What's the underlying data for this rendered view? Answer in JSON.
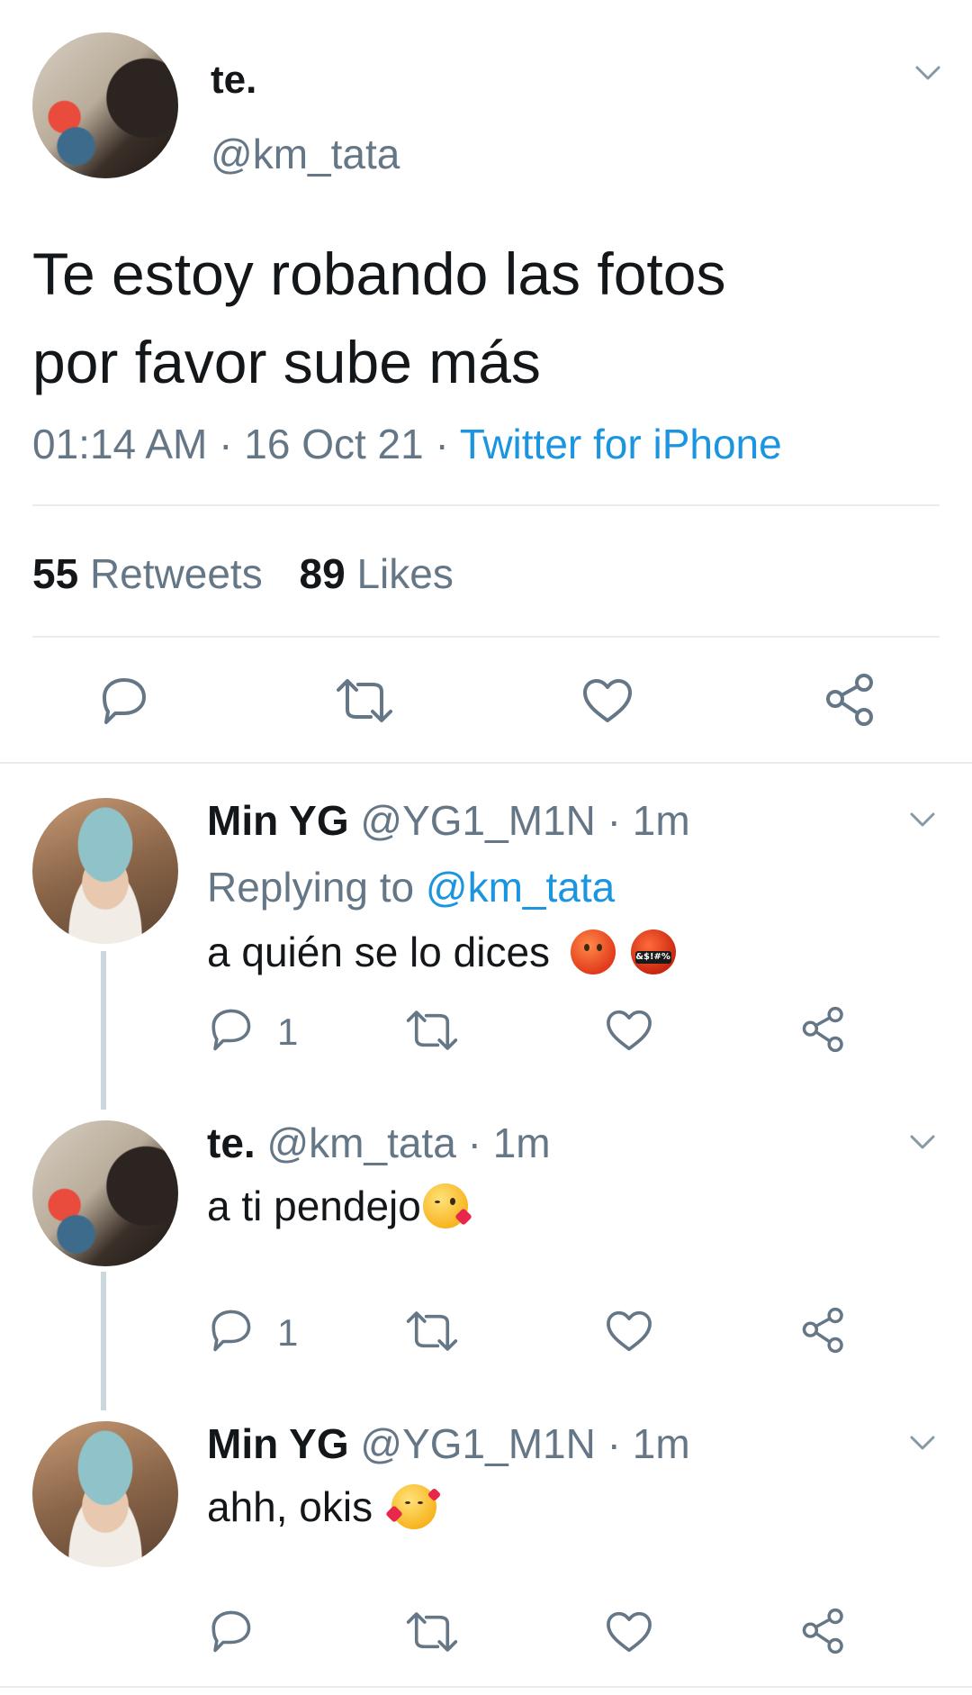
{
  "main_tweet": {
    "display_name": "te.",
    "handle": "@km_tata",
    "text_line1": "Te estoy robando las fotos",
    "text_line2": "por favor sube más",
    "time": "01:14 AM",
    "date": "16 Oct 21",
    "client": "Twitter for iPhone",
    "retweets_count": "55",
    "retweets_label": "Retweets",
    "likes_count": "89",
    "likes_label": "Likes"
  },
  "replies": [
    {
      "display_name": "Min YG",
      "handle": "@YG1_M1N",
      "time": "1m",
      "replying_to_label": "Replying to",
      "replying_to_handle": "@km_tata",
      "text": "a quién se lo dices",
      "emojis": [
        "angry-face",
        "face-with-symbols-on-mouth"
      ],
      "reply_count": "1"
    },
    {
      "display_name": "te.",
      "handle": "@km_tata",
      "time": "1m",
      "text": "a ti pendejo",
      "emojis": [
        "face-blowing-a-kiss"
      ],
      "reply_count": "1"
    },
    {
      "display_name": "Min YG",
      "handle": "@YG1_M1N",
      "time": "1m",
      "text": "ahh, okis",
      "emojis": [
        "smiling-face-with-hearts"
      ],
      "reply_count": ""
    }
  ],
  "separator": "·",
  "colors": {
    "link_blue": "#1b95e0",
    "secondary_grey": "#657786",
    "text": "#14171a",
    "divider": "#e6ecf0",
    "thread_line": "#ccd6dd"
  }
}
